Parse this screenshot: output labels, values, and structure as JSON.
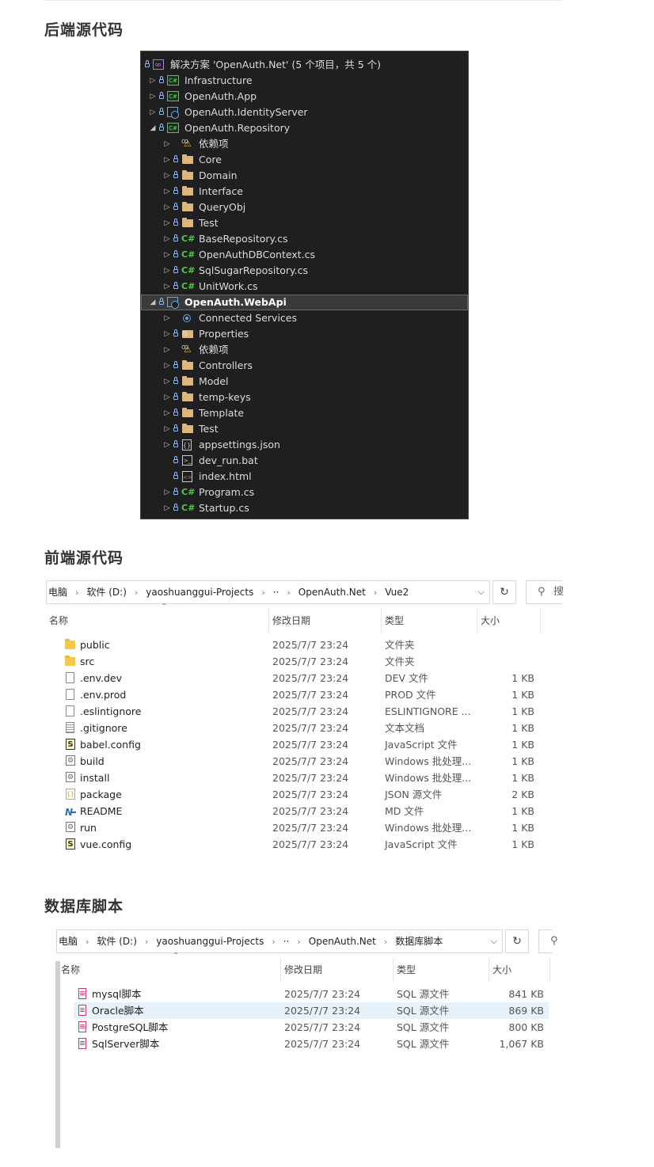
{
  "sections": {
    "backend_title": "后端源代码",
    "frontend_title": "前端源代码",
    "db_title": "数据库脚本"
  },
  "solution_explorer": {
    "items": [
      {
        "label": "解决方案 'OpenAuth.Net' (5 个项目，共 5 个)",
        "icon": "solution-icon",
        "indent": 0,
        "arrow": "",
        "lock": true
      },
      {
        "label": "Infrastructure",
        "icon": "csharp-project-icon",
        "indent": 0,
        "arrow": "▷",
        "lock": true
      },
      {
        "label": "OpenAuth.App",
        "icon": "csharp-project-icon",
        "indent": 0,
        "arrow": "▷",
        "lock": true
      },
      {
        "label": "OpenAuth.IdentityServer",
        "icon": "web-project-icon",
        "indent": 0,
        "arrow": "▷",
        "lock": true
      },
      {
        "label": "OpenAuth.Repository",
        "icon": "csharp-project-icon",
        "indent": 0,
        "arrow": "◢",
        "lock": true
      },
      {
        "label": "依赖项",
        "icon": "dependencies-icon",
        "indent": 1,
        "arrow": "▷",
        "lock": false
      },
      {
        "label": "Core",
        "icon": "folder-icon",
        "indent": 1,
        "arrow": "▷",
        "lock": true
      },
      {
        "label": "Domain",
        "icon": "folder-icon",
        "indent": 1,
        "arrow": "▷",
        "lock": true
      },
      {
        "label": "Interface",
        "icon": "folder-icon",
        "indent": 1,
        "arrow": "▷",
        "lock": true
      },
      {
        "label": "QueryObj",
        "icon": "folder-icon",
        "indent": 1,
        "arrow": "▷",
        "lock": true
      },
      {
        "label": "Test",
        "icon": "folder-icon",
        "indent": 1,
        "arrow": "▷",
        "lock": true
      },
      {
        "label": "BaseRepository.cs",
        "icon": "csharp-file-icon",
        "indent": 1,
        "arrow": "▷",
        "lock": true
      },
      {
        "label": "OpenAuthDBContext.cs",
        "icon": "csharp-file-icon",
        "indent": 1,
        "arrow": "▷",
        "lock": true
      },
      {
        "label": "SqlSugarRepository.cs",
        "icon": "csharp-file-icon",
        "indent": 1,
        "arrow": "▷",
        "lock": true
      },
      {
        "label": "UnitWork.cs",
        "icon": "csharp-file-icon",
        "indent": 1,
        "arrow": "▷",
        "lock": true
      },
      {
        "label": "OpenAuth.WebApi",
        "icon": "web-project-icon",
        "indent": 0,
        "arrow": "◢",
        "lock": true,
        "selected": true
      },
      {
        "label": "Connected Services",
        "icon": "connected-services-icon",
        "indent": 1,
        "arrow": "▷",
        "lock": false
      },
      {
        "label": "Properties",
        "icon": "properties-icon",
        "indent": 1,
        "arrow": "▷",
        "lock": true
      },
      {
        "label": "依赖项",
        "icon": "dependencies-icon",
        "indent": 1,
        "arrow": "▷",
        "lock": false
      },
      {
        "label": "Controllers",
        "icon": "folder-icon",
        "indent": 1,
        "arrow": "▷",
        "lock": true
      },
      {
        "label": "Model",
        "icon": "folder-icon",
        "indent": 1,
        "arrow": "▷",
        "lock": true
      },
      {
        "label": "temp-keys",
        "icon": "folder-icon",
        "indent": 1,
        "arrow": "▷",
        "lock": true
      },
      {
        "label": "Template",
        "icon": "folder-icon",
        "indent": 1,
        "arrow": "▷",
        "lock": true
      },
      {
        "label": "Test",
        "icon": "folder-icon",
        "indent": 1,
        "arrow": "▷",
        "lock": true
      },
      {
        "label": "appsettings.json",
        "icon": "json-file-icon",
        "indent": 1,
        "arrow": "▷",
        "lock": true
      },
      {
        "label": "dev_run.bat",
        "icon": "batch-file-icon",
        "indent": 1,
        "arrow": "",
        "lock": true
      },
      {
        "label": "index.html",
        "icon": "html-file-icon",
        "indent": 1,
        "arrow": "",
        "lock": true
      },
      {
        "label": "Program.cs",
        "icon": "csharp-file-icon",
        "indent": 1,
        "arrow": "▷",
        "lock": true
      },
      {
        "label": "Startup.cs",
        "icon": "csharp-file-icon",
        "indent": 1,
        "arrow": "▷",
        "lock": true
      }
    ]
  },
  "explorer_frontend": {
    "breadcrumbs": [
      "电脑",
      "软件 (D:)",
      "yaoshuanggui-Projects",
      "··",
      "OpenAuth.Net",
      "Vue2"
    ],
    "separator": "›",
    "dropdown": "⌵",
    "refresh": "↻",
    "search_icon": "⚲",
    "search_trunc": "搜",
    "columns": {
      "name": "名称",
      "date": "修改日期",
      "type": "类型",
      "size": "大小"
    },
    "sort_caret": "⌃",
    "rows": [
      {
        "name": "public",
        "date": "2025/7/7 23:24",
        "type": "文件夹",
        "size": "",
        "icon": "folder-icon"
      },
      {
        "name": "src",
        "date": "2025/7/7 23:24",
        "type": "文件夹",
        "size": "",
        "icon": "folder-icon"
      },
      {
        "name": ".env.dev",
        "date": "2025/7/7 23:24",
        "type": "DEV 文件",
        "size": "1 KB",
        "icon": "file-icon"
      },
      {
        "name": ".env.prod",
        "date": "2025/7/7 23:24",
        "type": "PROD 文件",
        "size": "1 KB",
        "icon": "file-icon"
      },
      {
        "name": ".eslintignore",
        "date": "2025/7/7 23:24",
        "type": "ESLINTIGNORE ...",
        "size": "1 KB",
        "icon": "file-icon"
      },
      {
        "name": ".gitignore",
        "date": "2025/7/7 23:24",
        "type": "文本文档",
        "size": "1 KB",
        "icon": "text-file-icon"
      },
      {
        "name": "babel.config",
        "date": "2025/7/7 23:24",
        "type": "JavaScript 文件",
        "size": "1 KB",
        "icon": "js-file-icon"
      },
      {
        "name": "build",
        "date": "2025/7/7 23:24",
        "type": "Windows 批处理...",
        "size": "1 KB",
        "icon": "batch-file-icon"
      },
      {
        "name": "install",
        "date": "2025/7/7 23:24",
        "type": "Windows 批处理...",
        "size": "1 KB",
        "icon": "batch-file-icon"
      },
      {
        "name": "package",
        "date": "2025/7/7 23:24",
        "type": "JSON 源文件",
        "size": "2 KB",
        "icon": "json-file-icon"
      },
      {
        "name": "README",
        "date": "2025/7/7 23:24",
        "type": "MD 文件",
        "size": "1 KB",
        "icon": "markdown-file-icon"
      },
      {
        "name": "run",
        "date": "2025/7/7 23:24",
        "type": "Windows 批处理...",
        "size": "1 KB",
        "icon": "batch-file-icon"
      },
      {
        "name": "vue.config",
        "date": "2025/7/7 23:24",
        "type": "JavaScript 文件",
        "size": "1 KB",
        "icon": "js-file-icon"
      }
    ]
  },
  "explorer_db": {
    "breadcrumbs": [
      "电脑",
      "软件 (D:)",
      "yaoshuanggui-Projects",
      "··",
      "OpenAuth.Net",
      "数据库脚本"
    ],
    "separator": "›",
    "dropdown": "⌵",
    "refresh": "↻",
    "search_icon": "⚲",
    "search_trunc": "",
    "columns": {
      "name": "名称",
      "date": "修改日期",
      "type": "类型",
      "size": "大小"
    },
    "sort_caret": "⌃",
    "rows": [
      {
        "name": "mysql脚本",
        "date": "2025/7/7 23:24",
        "type": "SQL 源文件",
        "size": "841 KB",
        "icon": "sql-file-icon"
      },
      {
        "name": "Oracle脚本",
        "date": "2025/7/7 23:24",
        "type": "SQL 源文件",
        "size": "869 KB",
        "icon": "sql-file-icon",
        "selected": true
      },
      {
        "name": "PostgreSQL脚本",
        "date": "2025/7/7 23:24",
        "type": "SQL 源文件",
        "size": "800 KB",
        "icon": "sql-file-icon"
      },
      {
        "name": "SqlServer脚本",
        "date": "2025/7/7 23:24",
        "type": "SQL 源文件",
        "size": "1,067 KB",
        "icon": "sql-file-icon"
      }
    ]
  }
}
